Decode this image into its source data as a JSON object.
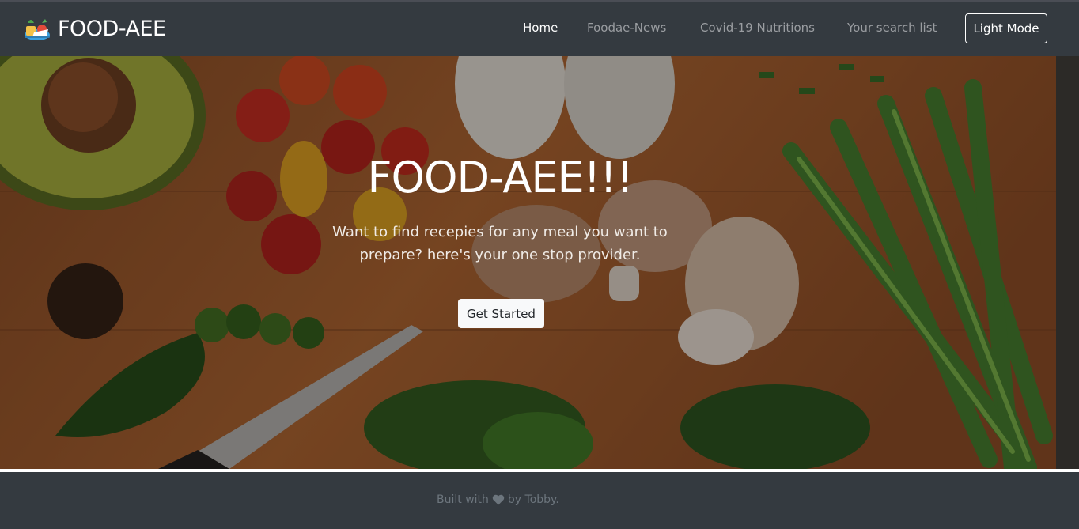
{
  "navbar": {
    "brand": "FOOD-AEE",
    "links": [
      {
        "label": "Home",
        "active": true
      },
      {
        "label": "Foodae-News",
        "active": false
      },
      {
        "label": "Covid-19 Nutritions",
        "active": false
      },
      {
        "label": "Your search list",
        "active": false
      }
    ],
    "mode_button": "Light Mode"
  },
  "hero": {
    "title": "FOOD-AEE!!!",
    "subtitle": "Want to find recepies for any meal you want to prepare? here's your one stop provider.",
    "cta_label": "Get Started"
  },
  "footer": {
    "prefix": "Built with",
    "suffix": "by Tobby.",
    "icon": "heart-icon"
  },
  "colors": {
    "navbar_bg": "#343a40",
    "footer_text": "#6c757d",
    "nav_inactive": "#9a9da1",
    "white": "#ffffff"
  }
}
